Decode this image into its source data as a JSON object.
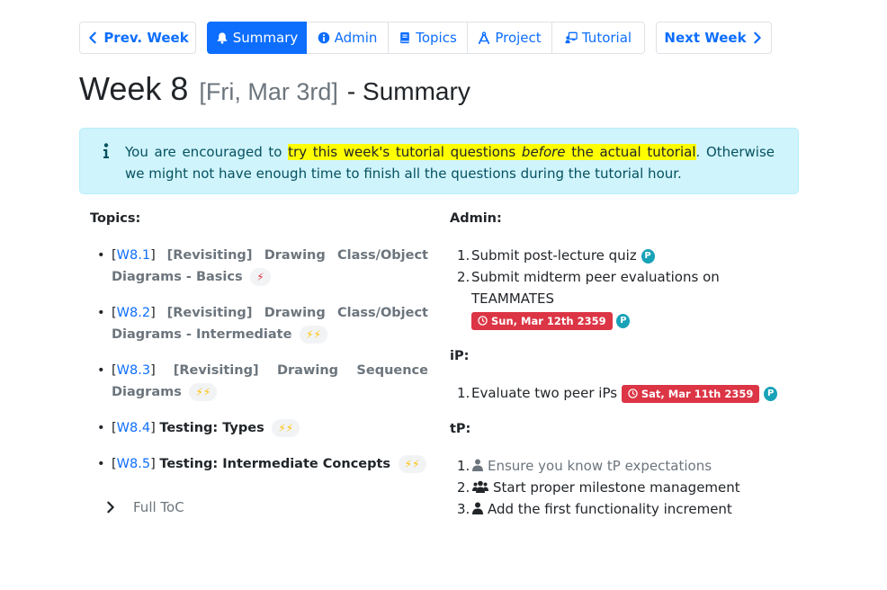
{
  "nav": {
    "prev": "Prev. Week",
    "next": "Next Week",
    "tabs": [
      "Summary",
      "Admin",
      "Topics",
      "Project",
      "Tutorial"
    ],
    "active_tab": "Summary",
    "accent": "#0d6efd"
  },
  "heading": {
    "week": "Week 8",
    "date": "[Fri, Mar 3rd]",
    "suffix": "- Summary"
  },
  "alert": {
    "pre": "You are encouraged to ",
    "hl1": "try this week's tutorial questions ",
    "hl_em": "before",
    "hl2": " the actual tutorial",
    "post": ". Otherwise we might not have enough time to finish all the questions during the tutorial hour."
  },
  "topics": {
    "title": "Topics:",
    "items": [
      {
        "code": "W8.1",
        "title": "[Revisiting] Drawing Class/Object Diagrams - Basics",
        "bolts": "⚡",
        "level": 1
      },
      {
        "code": "W8.2",
        "title": "[Revisiting] Drawing Class/Object Diagrams - Intermediate",
        "bolts": "⚡⚡",
        "level": 2
      },
      {
        "code": "W8.3",
        "title": "[Revisiting] Drawing Sequence Diagrams",
        "bolts": "⚡⚡",
        "level": 2
      },
      {
        "code": "W8.4",
        "title": "Testing: Types",
        "bolts": "⚡⚡",
        "level": 2
      },
      {
        "code": "W8.5",
        "title": "Testing: Intermediate Concepts",
        "bolts": "⚡⚡",
        "level": 2
      }
    ],
    "toc_label": "Full ToC"
  },
  "admin": {
    "title": "Admin:",
    "items": [
      {
        "n": "1.",
        "text": "Submit post-lecture quiz",
        "badge": "P"
      },
      {
        "n": "2.",
        "text": "Submit midterm peer evaluations on TEAMMATES",
        "due": "Sun, Mar 12th 2359",
        "badge": "P"
      }
    ]
  },
  "ip": {
    "title": "iP:",
    "items": [
      {
        "n": "1.",
        "text": "Evaluate two peer iPs",
        "due": "Sat, Mar 11th 2359",
        "badge": "P"
      }
    ]
  },
  "tp": {
    "title": "tP:",
    "items": [
      {
        "n": "1.",
        "text": "Ensure you know tP expectations",
        "icon": "person-icon"
      },
      {
        "n": "2.",
        "text": "Start proper milestone management",
        "icon": "people-icon"
      },
      {
        "n": "3.",
        "text": "Add the first functionality increment",
        "icon": "person-icon"
      }
    ]
  },
  "colors": {
    "danger": "#dc3545",
    "info_bg": "#cff4fc",
    "badge": "#17a2b8",
    "highlight": "#ffff00"
  }
}
